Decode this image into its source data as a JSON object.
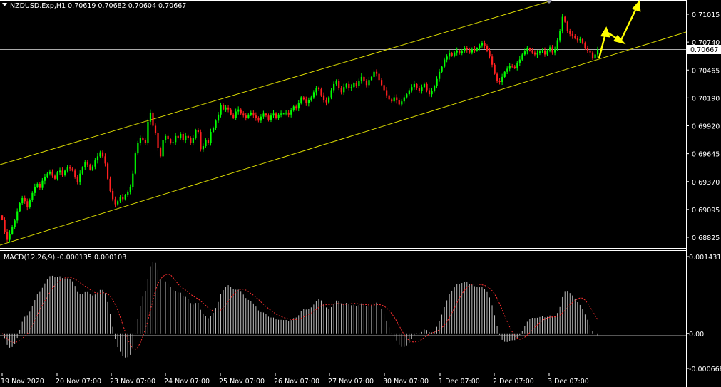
{
  "header": {
    "symbol_line": "NZDUSD.Exp,H1  0.70619 0.70682 0.70604 0.70667"
  },
  "macd": {
    "label": "MACD(12,26,9) -0.000135 0.000103"
  },
  "colors": {
    "background": "#000000",
    "bull": "#00ff00",
    "bear": "#ff2020",
    "channel": "#d8d800",
    "arrows": "#ffff00",
    "histogram": "#c0c0c0",
    "signal": "#ff3030",
    "axis_text": "#ffffff",
    "price_marker_bg": "#ffffff"
  },
  "chart_data": [
    {
      "type": "candlestick",
      "title": "NZDUSD.Exp,H1",
      "ohlc_last": {
        "open": 0.70619,
        "high": 0.70682,
        "low": 0.70604,
        "close": 0.70667
      },
      "y_ticks": [
        "0.71015",
        "0.70740",
        "0.70465",
        "0.70190",
        "0.69920",
        "0.69645",
        "0.69370",
        "0.69095",
        "0.68825"
      ],
      "current_price_label": "0.70667",
      "x_ticks": [
        "19 Nov 2020",
        "20 Nov 07:00",
        "23 Nov 07:00",
        "24 Nov 07:00",
        "25 Nov 07:00",
        "26 Nov 07:00",
        "27 Nov 07:00",
        "30 Nov 07:00",
        "1 Dec 07:00",
        "2 Dec 07:00",
        "3 Dec 07:00"
      ],
      "ylim": [
        0.6877,
        0.7121
      ],
      "closes": [
        0.69,
        0.6888,
        0.688,
        0.6886,
        0.6893,
        0.6899,
        0.6908,
        0.6916,
        0.6921,
        0.6918,
        0.6912,
        0.6919,
        0.6926,
        0.6932,
        0.6935,
        0.6931,
        0.6938,
        0.6942,
        0.6945,
        0.6947,
        0.6943,
        0.694,
        0.6946,
        0.6948,
        0.6944,
        0.6948,
        0.6951,
        0.695,
        0.6948,
        0.6942,
        0.6937,
        0.6945,
        0.6951,
        0.6956,
        0.6954,
        0.6949,
        0.6952,
        0.6958,
        0.6962,
        0.6966,
        0.6962,
        0.6955,
        0.694,
        0.6928,
        0.692,
        0.6915,
        0.6918,
        0.6922,
        0.692,
        0.6924,
        0.6927,
        0.6932,
        0.6945,
        0.6965,
        0.6975,
        0.698,
        0.6978,
        0.6975,
        0.6996,
        0.7005,
        0.6992,
        0.6985,
        0.697,
        0.6962,
        0.6978,
        0.6982,
        0.6979,
        0.6975,
        0.6976,
        0.6982,
        0.698,
        0.6984,
        0.6978,
        0.6982,
        0.698,
        0.6975,
        0.698,
        0.6988,
        0.6986,
        0.6969,
        0.6972,
        0.6978,
        0.6975,
        0.6986,
        0.699,
        0.6997,
        0.7003,
        0.7012,
        0.7008,
        0.701,
        0.7008,
        0.7003,
        0.7,
        0.7006,
        0.7008,
        0.7004,
        0.7002,
        0.7,
        0.7003,
        0.7005,
        0.7002,
        0.7,
        0.6997,
        0.7001,
        0.7004,
        0.7002,
        0.6998,
        0.7002,
        0.7004,
        0.7,
        0.7003,
        0.7004,
        0.7004,
        0.7005,
        0.7003,
        0.7007,
        0.7011,
        0.7009,
        0.7014,
        0.702,
        0.7018,
        0.7014,
        0.7017,
        0.702,
        0.7025,
        0.7029,
        0.7028,
        0.7022,
        0.7017,
        0.7015,
        0.702,
        0.7027,
        0.7033,
        0.7036,
        0.7029,
        0.7025,
        0.703,
        0.7033,
        0.7029,
        0.703,
        0.7034,
        0.7031,
        0.7036,
        0.704,
        0.7036,
        0.7032,
        0.7037,
        0.704,
        0.7045,
        0.7043,
        0.7037,
        0.7032,
        0.7027,
        0.7022,
        0.7018,
        0.7016,
        0.702,
        0.7017,
        0.7013,
        0.7016,
        0.702,
        0.7023,
        0.7027,
        0.703,
        0.7033,
        0.7029,
        0.7026,
        0.703,
        0.7033,
        0.7027,
        0.7023,
        0.7026,
        0.7031,
        0.7038,
        0.7045,
        0.705,
        0.7057,
        0.706,
        0.7063,
        0.7061,
        0.7064,
        0.7066,
        0.7063,
        0.7065,
        0.7068,
        0.7067,
        0.7064,
        0.7067,
        0.7066,
        0.7068,
        0.7071,
        0.7073,
        0.707,
        0.7066,
        0.706,
        0.7052,
        0.7043,
        0.7036,
        0.7035,
        0.704,
        0.7045,
        0.7048,
        0.7051,
        0.705,
        0.7049,
        0.7054,
        0.7057,
        0.7062,
        0.7065,
        0.7068,
        0.7066,
        0.7064,
        0.7062,
        0.7063,
        0.7065,
        0.7066,
        0.7062,
        0.7066,
        0.7069,
        0.7064,
        0.7067,
        0.7076,
        0.7085,
        0.7099,
        0.7094,
        0.7085,
        0.7082,
        0.708,
        0.7078,
        0.7076,
        0.7077,
        0.7073,
        0.7068,
        0.7066,
        0.7064,
        0.7058,
        0.7062,
        0.7067
      ]
    },
    {
      "type": "bar",
      "title": "MACD(12,26,9)",
      "values_last": {
        "macd": -0.000135,
        "signal": 0.000103
      },
      "y_ticks": [
        "0.001431",
        "0.00",
        "-0.000668"
      ],
      "ylim": [
        -0.000668,
        0.001431
      ]
    }
  ],
  "annotations": [
    "ascending channel (upper and lower trendlines)",
    "upward projection arrows"
  ]
}
